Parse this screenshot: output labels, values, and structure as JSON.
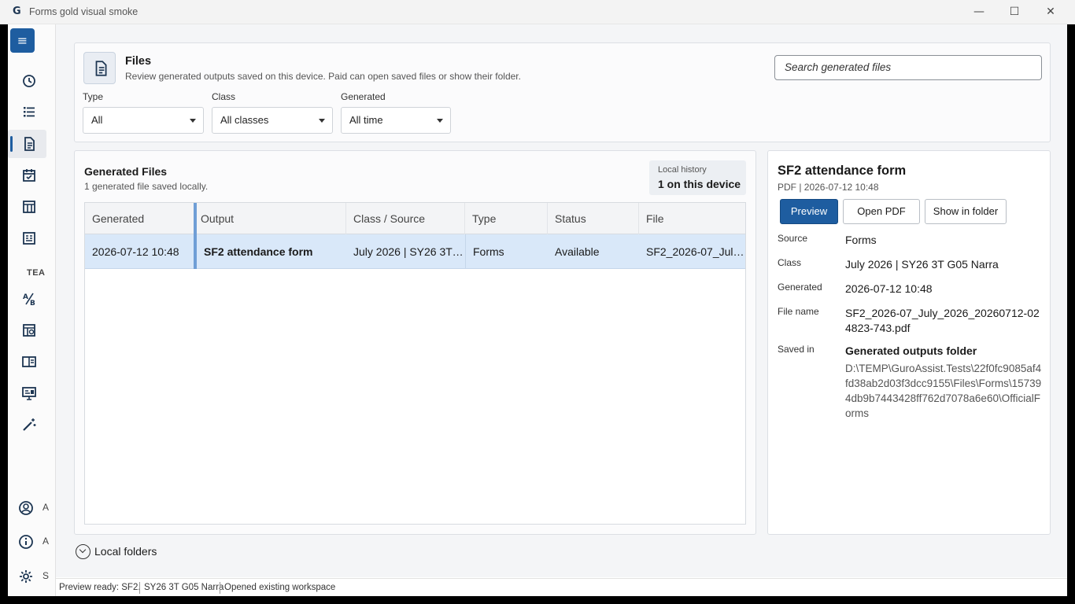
{
  "window": {
    "title": "Forms gold visual smoke",
    "logo_glyph": "G",
    "minimize": "—",
    "maximize": "☐",
    "close": "✕"
  },
  "nav": {
    "menu_glyph": "≡",
    "section_label": "TEA",
    "bottom_labels": [
      "A",
      "A",
      "S"
    ]
  },
  "header": {
    "title": "Files",
    "subtitle": "Review generated outputs saved on this device. Paid can open saved files or show their folder.",
    "search_placeholder": "Search generated files"
  },
  "filters": {
    "type": {
      "label": "Type",
      "value": "All"
    },
    "class": {
      "label": "Class",
      "value": "All classes"
    },
    "generated": {
      "label": "Generated",
      "value": "All time"
    }
  },
  "list": {
    "title": "Generated Files",
    "subtitle": "1 generated file saved locally.",
    "history_label": "Local history",
    "history_value": "1 on this device",
    "columns": [
      "Generated",
      "Output",
      "Class / Source",
      "Type",
      "Status",
      "File"
    ],
    "rows": [
      {
        "generated": "2026-07-12 10:48",
        "output": "SF2 attendance form",
        "class_source": "July 2026 | SY26 3T G05 Narra",
        "type": "Forms",
        "status": "Available",
        "file": "SF2_2026-07_July_2026_20260712-024823-743.pdf"
      }
    ]
  },
  "local_folders": "Local folders",
  "detail": {
    "title": "SF2 attendance form",
    "meta": "PDF | 2026-07-12 10:48",
    "preview_button": "Preview",
    "open_pdf_button": "Open PDF",
    "show_folder_button": "Show in folder",
    "source_label": "Source",
    "source_value": "Forms",
    "class_label": "Class",
    "class_value": "July 2026 | SY26 3T G05 Narra",
    "generated_label": "Generated",
    "generated_value": "2026-07-12 10:48",
    "file_name_label": "File name",
    "file_name_value": "SF2_2026-07_July_2026_20260712-024823-743.pdf",
    "saved_in_label": "Saved in",
    "saved_in_value": "Generated outputs folder",
    "saved_path": "D:\\TEMP\\GuroAssist.Tests\\22f0fc9085af4fd38ab2d03f3dcc9155\\Files\\Forms\\157394db9b7443428ff762d7078a6e60\\OfficialForms"
  },
  "status": {
    "message": "Preview ready: SF2.",
    "class": "SY26 3T G05 Narra",
    "workspace": "Opened existing workspace"
  },
  "colors": {
    "accent": "#1e5da0",
    "selected_row": "#d9e8f9",
    "column_separator": "#6f9ed6"
  }
}
